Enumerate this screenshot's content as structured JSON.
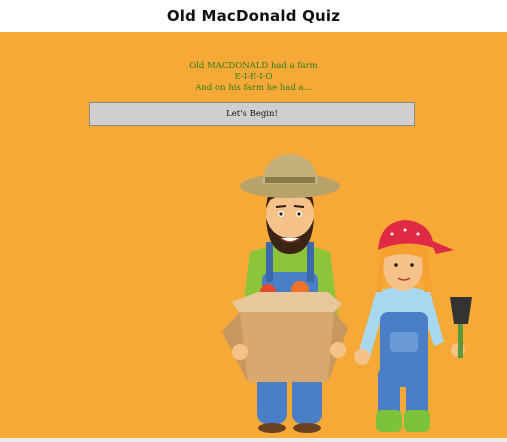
{
  "header": {
    "title": "Old MacDonald Quiz"
  },
  "intro": {
    "line1": "Old MACDONALD had a farm",
    "line2": "E-I-E-I-O",
    "line3": "And on his farm he had a..."
  },
  "actions": {
    "begin_label": "Let's Begin!"
  },
  "illustration": {
    "farmer": "farmer-with-box-of-apples",
    "girl": "farm-girl-with-shovel",
    "colors": {
      "background": "#f6a937",
      "text": "#2e7d1e",
      "button": "#cfcfcf"
    }
  }
}
